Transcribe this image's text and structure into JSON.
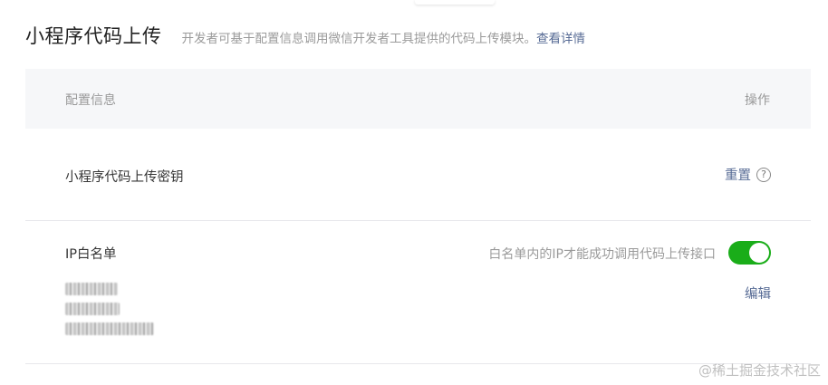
{
  "header": {
    "title": "小程序代码上传",
    "description": "开发者可基于配置信息调用微信开发者工具提供的代码上传模块。",
    "details_link": "查看详情"
  },
  "table": {
    "col_config": "配置信息",
    "col_action": "操作"
  },
  "secret_row": {
    "label": "小程序代码上传密钥",
    "action": "重置",
    "help_glyph": "?"
  },
  "ip_row": {
    "label": "IP白名单",
    "hint": "白名单内的IP才能成功调用代码上传接口",
    "toggle_on": true,
    "edit": "编辑",
    "ip_count": 3
  },
  "watermark": "@稀土掘金技术社区",
  "colors": {
    "link": "#576b95",
    "toggle_on": "#1aad19"
  }
}
